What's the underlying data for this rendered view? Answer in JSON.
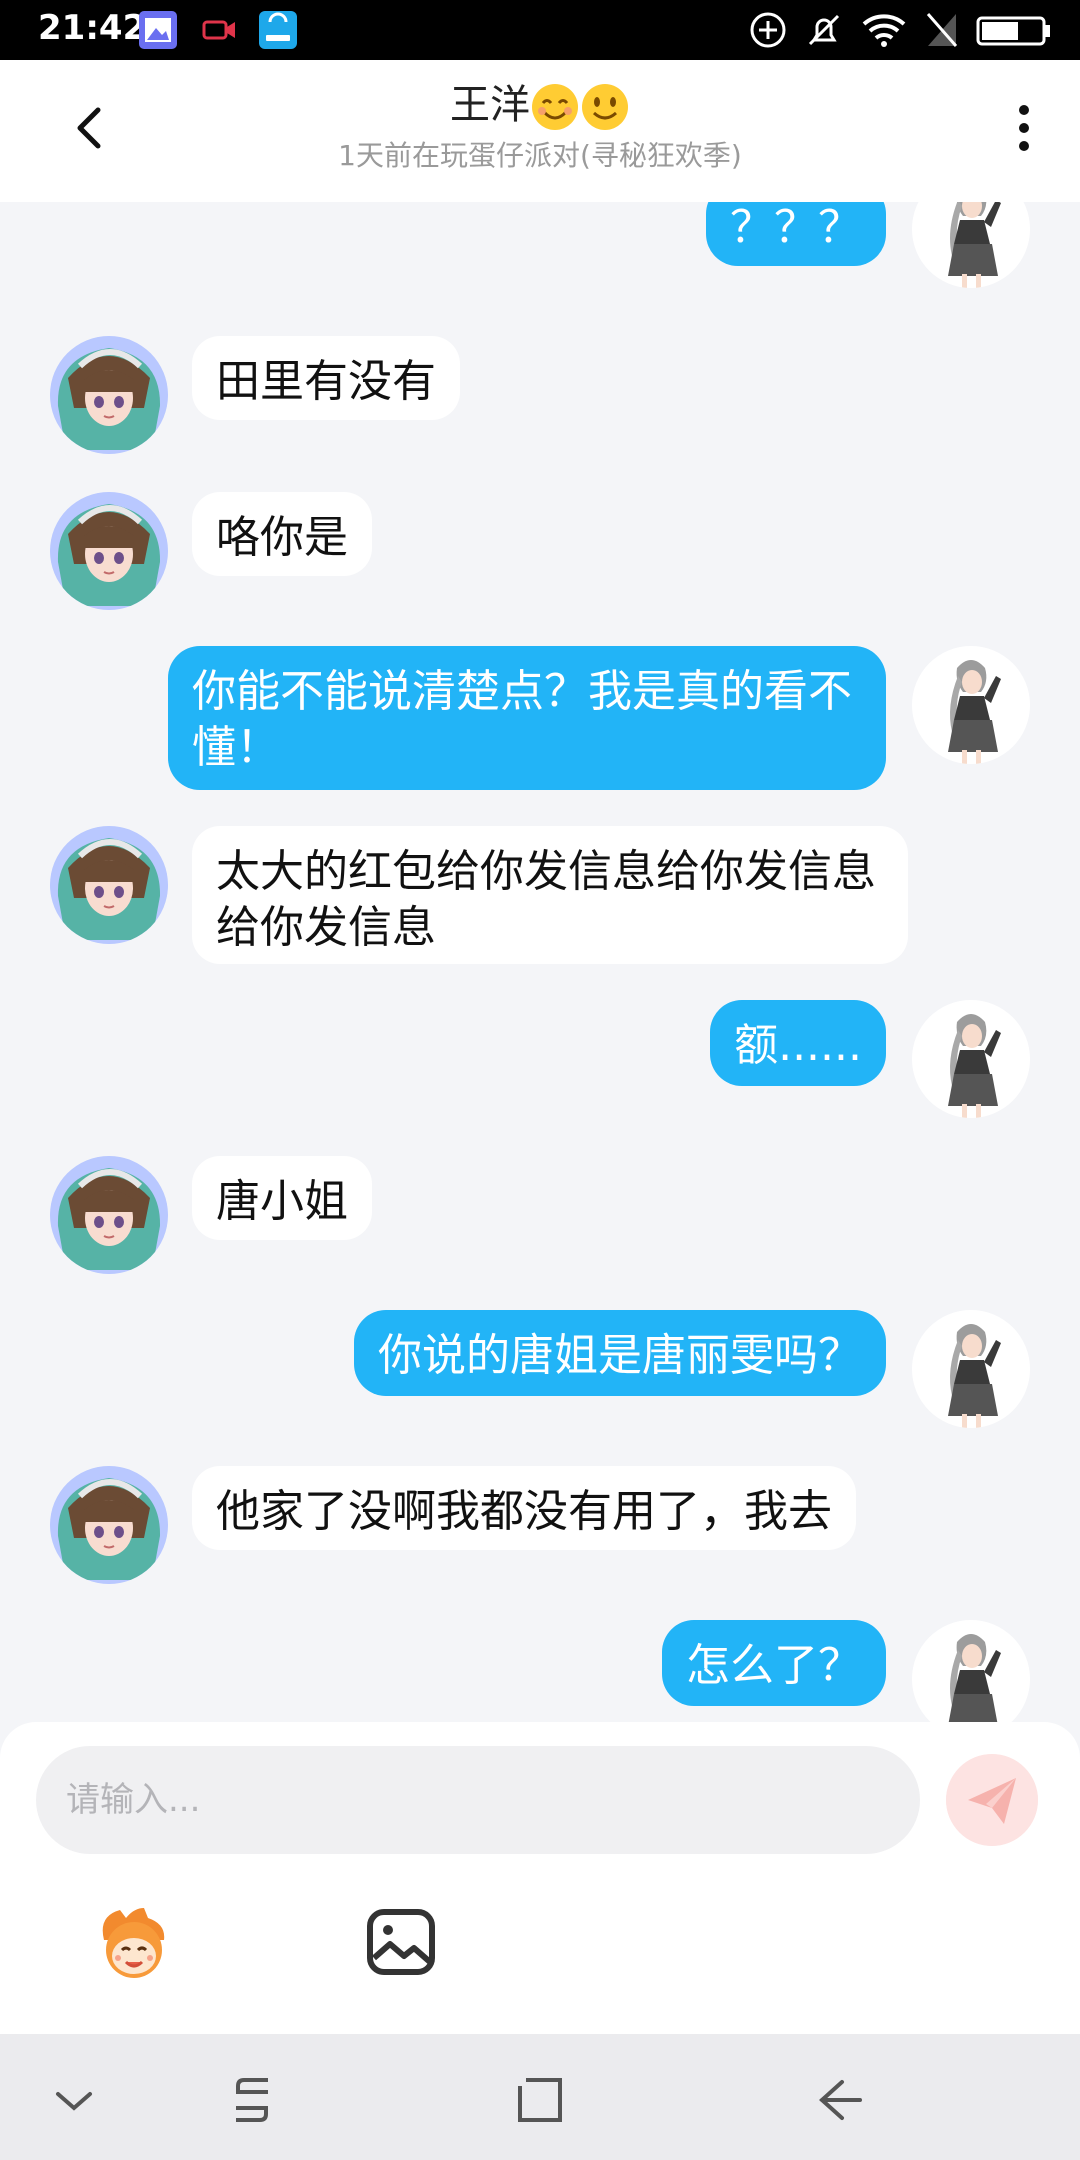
{
  "status_bar": {
    "time": "21:42"
  },
  "header": {
    "title": "王洋",
    "subtitle": "1天前在玩蛋仔派对(寻秘狂欢季)"
  },
  "messages": [
    {
      "from": "me",
      "text": "？？？"
    },
    {
      "from": "friend",
      "text": "田里有没有"
    },
    {
      "from": "friend",
      "text": "咯你是"
    },
    {
      "from": "me",
      "text": "你能不能说清楚点？我是真的看不懂！"
    },
    {
      "from": "friend",
      "text": "太大的红包给你发信息给你发信息给你发信息"
    },
    {
      "from": "me",
      "text": "额......"
    },
    {
      "from": "friend",
      "text": "唐小姐"
    },
    {
      "from": "me",
      "text": "你说的唐姐是唐丽雯吗？"
    },
    {
      "from": "friend",
      "text": "他家了没啊我都没有用了，我去"
    },
    {
      "from": "me",
      "text": "怎么了？"
    }
  ],
  "composer": {
    "placeholder": "请输入...",
    "input_value": ""
  },
  "colors": {
    "outgoing_bubble": "#22b4f7",
    "incoming_bubble": "#ffffff",
    "background": "#f4f5f8",
    "send_button": "#fde3e2",
    "send_icon": "#f6b2ad"
  },
  "icons": {
    "back": "chevron-left-icon",
    "more": "more-vertical-icon",
    "send": "paper-plane-icon",
    "emoji": "mascot-emoji-icon",
    "image": "image-icon",
    "nav": [
      "chevron-down-icon",
      "recent-apps-icon",
      "home-icon",
      "back-arrow-icon"
    ]
  }
}
